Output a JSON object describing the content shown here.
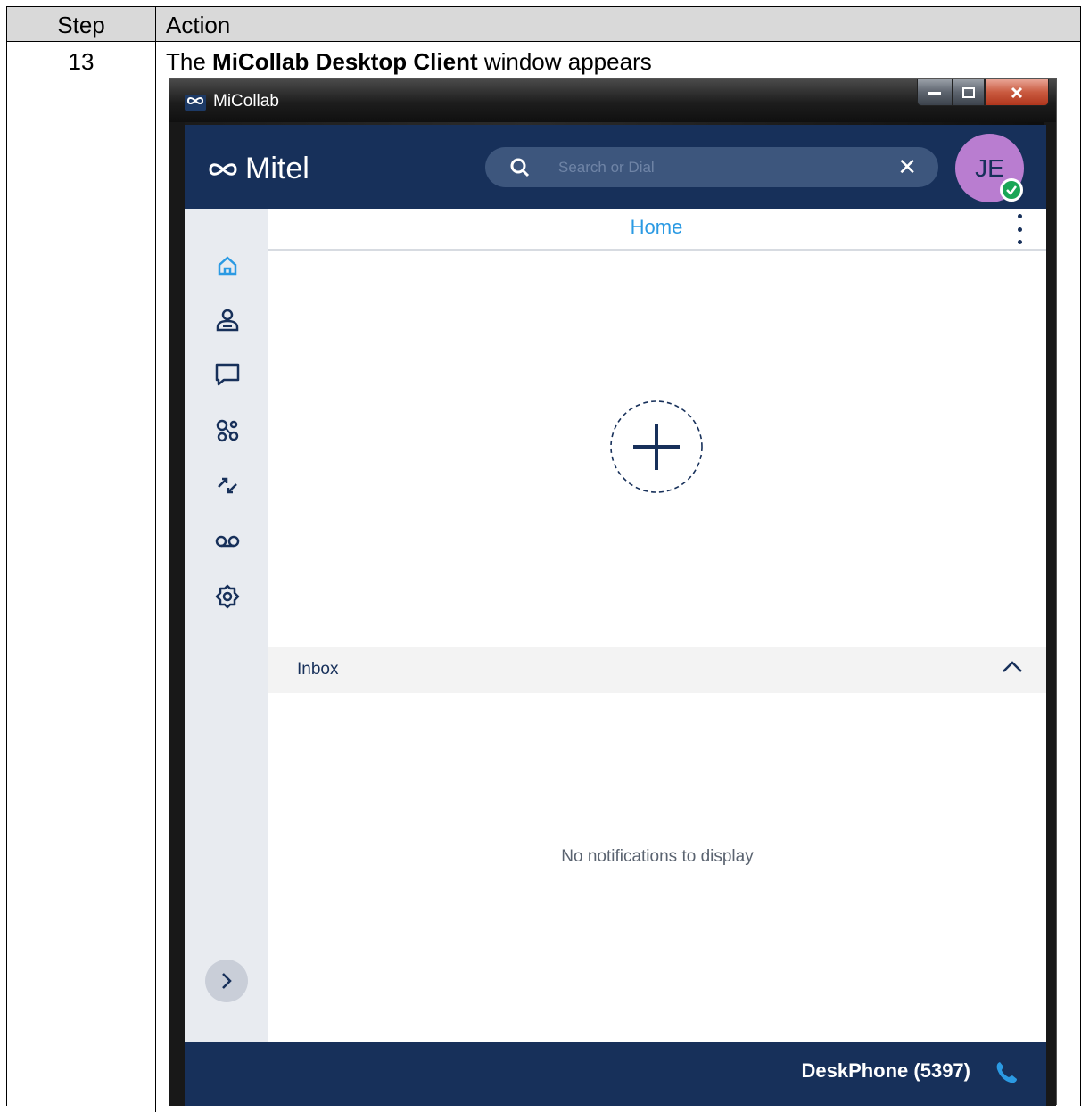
{
  "table": {
    "header_step": "Step",
    "header_action": "Action",
    "step_number": "13",
    "step_text_prefix": "The ",
    "step_text_bold": "MiCollab Desktop Client",
    "step_text_suffix": " window appears"
  },
  "window": {
    "title": "MiCollab",
    "title_icon": "micollab-logo"
  },
  "app": {
    "brand": "Mitel",
    "search": {
      "placeholder": "Search or Dial",
      "value": ""
    },
    "avatar_initials": "JE",
    "presence": "available",
    "nav_items": [
      {
        "name": "home",
        "icon": "home-icon",
        "active": true
      },
      {
        "name": "contacts",
        "icon": "contacts-icon"
      },
      {
        "name": "chat",
        "icon": "chat-icon"
      },
      {
        "name": "collaboration",
        "icon": "collaboration-icon"
      },
      {
        "name": "call-history",
        "icon": "call-history-icon"
      },
      {
        "name": "voicemail",
        "icon": "voicemail-icon"
      },
      {
        "name": "settings",
        "icon": "gear-icon"
      }
    ],
    "home_title": "Home",
    "inbox_label": "Inbox",
    "inbox_empty": "No notifications to display",
    "device_label": "DeskPhone (5397)"
  },
  "colors": {
    "navy": "#17305a",
    "accent": "#2b9ae3",
    "avatar": "#b97dd0",
    "presence_green": "#1aa556",
    "sidebar": "#e8ebf0"
  }
}
